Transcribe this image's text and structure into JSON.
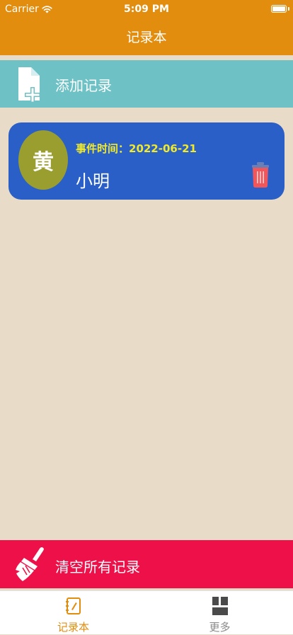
{
  "status_bar": {
    "carrier": "Carrier",
    "time": "5:09 PM"
  },
  "nav": {
    "title": "记录本"
  },
  "add_record": {
    "label": "添加记录"
  },
  "records": [
    {
      "avatar_char": "黄",
      "event_time": "事件时间：2022-06-21",
      "name": "小明"
    }
  ],
  "clear_all": {
    "label": "清空所有记录"
  },
  "tabs": [
    {
      "label": "记录本",
      "icon": "notebook-icon",
      "selected": true
    },
    {
      "label": "更多",
      "icon": "grid-icon",
      "selected": false
    }
  ],
  "colors": {
    "header": "#e38d0e",
    "background": "#e8dcc9",
    "add_bar": "#6ec2c5",
    "card": "#2b5fc8",
    "avatar": "#9a9e2e",
    "event_time": "#f0ea2a",
    "trash": "#f0565a",
    "clear_bar": "#ee1149",
    "tab_active": "#e38d0e",
    "tab_inactive": "#8a8a8a"
  }
}
